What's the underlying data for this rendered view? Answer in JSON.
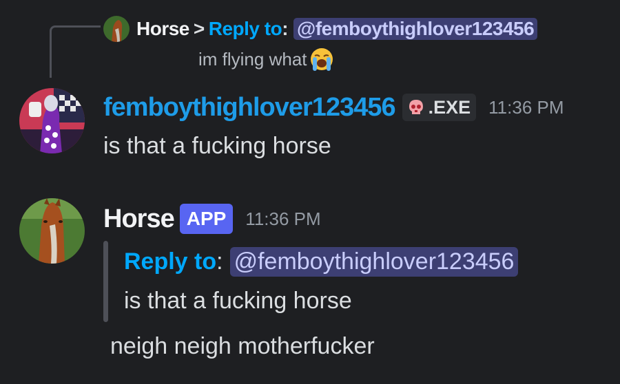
{
  "reply_preview": {
    "author": "Horse",
    "separator": ">",
    "reply_to_label": "Reply to",
    "colon": ":",
    "mention": "@femboythighlover123456",
    "content": "im flying what",
    "emoji": "loudly-crying-face"
  },
  "message1": {
    "username": "femboythighlover123456",
    "role_tag": ".EXE",
    "role_icon": "skull-icon",
    "timestamp": "11:36 PM",
    "text": "is that a fucking horse"
  },
  "message2": {
    "username": "Horse",
    "badge": "APP",
    "timestamp": "11:36 PM",
    "quote": {
      "reply_to_label": "Reply to",
      "colon": ":",
      "mention": "@femboythighlover123456",
      "text": "is that a fucking horse"
    },
    "text": "neigh neigh motherfucker"
  },
  "colors": {
    "background": "#1e1f22",
    "username_blue": "#1e9ce8",
    "reply_link": "#00a8fc",
    "mention_bg": "#3d3f73",
    "app_badge": "#5865f2",
    "timestamp": "#949ba4"
  }
}
